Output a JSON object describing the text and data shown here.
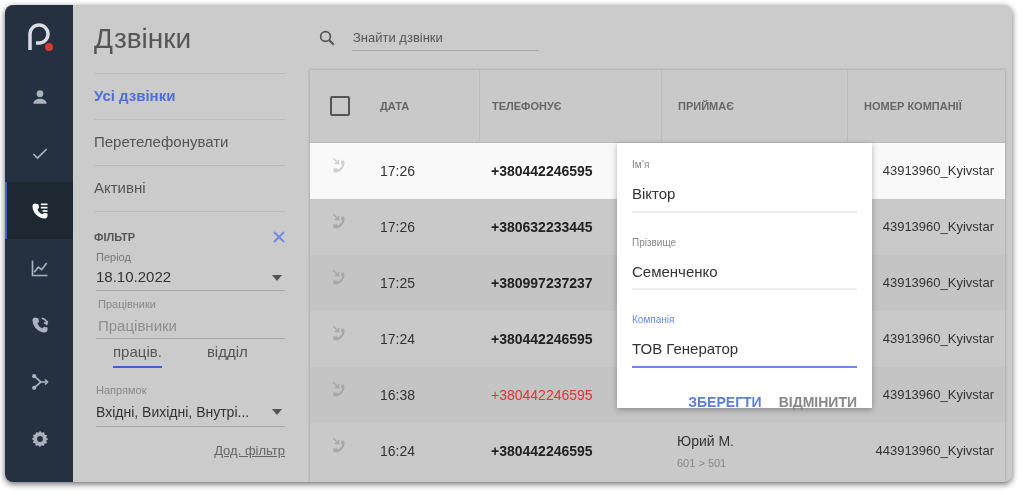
{
  "sidebar": {
    "items": [
      {
        "selected": false
      },
      {
        "selected": false
      },
      {
        "selected": true
      },
      {
        "selected": false
      },
      {
        "selected": false
      },
      {
        "selected": false
      },
      {
        "selected": false
      }
    ]
  },
  "page_title": "Дзвінки",
  "search": {
    "placeholder": "Знайти дзвінки"
  },
  "nav": [
    {
      "label": "Усі дзвінки",
      "selected": true
    },
    {
      "label": "Перетелефонувати",
      "selected": false
    },
    {
      "label": "Активні",
      "selected": false
    }
  ],
  "filter": {
    "title": "ФІЛЬТР",
    "period": {
      "label": "Період",
      "value": "18.10.2022"
    },
    "employees": {
      "label": "Працівники",
      "placeholder": "Працівники"
    },
    "tabs": [
      {
        "label": "праців.",
        "selected": true
      },
      {
        "label": "відділ",
        "selected": false
      }
    ],
    "direction": {
      "label": "Напрямок",
      "value": "Вхідні, Вихідні, Внутрі..."
    },
    "more_link": "Дод. фільтр"
  },
  "table": {
    "columns": [
      "ДАТА",
      "ТЕЛЕФОНУЄ",
      "ПРИЙМАЄ",
      "НОМЕР КОМПАНІЇ"
    ],
    "select_all": {
      "checked": false
    },
    "rows": [
      {
        "time": "17:26",
        "caller": "+380442246595",
        "missed": false,
        "highlighted": true,
        "company": "43913960_Kyivstar"
      },
      {
        "time": "17:26",
        "caller": "+380632233445",
        "missed": false,
        "highlighted": false,
        "company": "43913960_Kyivstar"
      },
      {
        "time": "17:25",
        "caller": "+380997237237",
        "missed": false,
        "highlighted": false,
        "company": "43913960_Kyivstar"
      },
      {
        "time": "17:24",
        "caller": "+380442246595",
        "missed": false,
        "highlighted": false,
        "company": "43913960_Kyivstar"
      },
      {
        "time": "16:38",
        "caller": "+380442246595",
        "missed": true,
        "highlighted": false,
        "company": "43913960_Kyivstar"
      },
      {
        "time": "16:24",
        "caller": "+380442246595",
        "missed": false,
        "highlighted": false,
        "receiver": "Юрий М.",
        "extension": "601 > 501",
        "company": "443913960_Kyivstar"
      }
    ]
  },
  "edit_popup": {
    "fields": [
      {
        "label": "Ім’я",
        "value": "Віктор",
        "focused": false
      },
      {
        "label": "Прізвище",
        "value": "Семенченко",
        "focused": false
      },
      {
        "label": "Компанія",
        "value": "ТОВ Генератор",
        "focused": true
      }
    ],
    "buttons": [
      {
        "label": "ЗБЕРЕГТИ",
        "kind": "primary"
      },
      {
        "label": "ВІДМІНИТИ",
        "kind": "secondary"
      }
    ]
  }
}
